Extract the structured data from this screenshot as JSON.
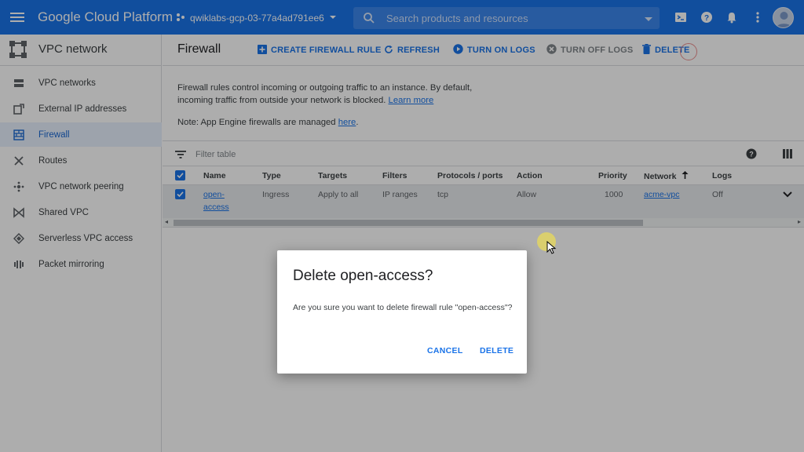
{
  "topbar": {
    "brand": "Google Cloud Platform",
    "project": "qwiklabs-gcp-03-77a4ad791ee6",
    "search_placeholder": "Search products and resources",
    "icons": [
      "menu-icon",
      "project-hub-icon",
      "search-icon",
      "cloud-shell-icon",
      "help-icon",
      "notifications-icon",
      "more-vert-icon",
      "avatar"
    ],
    "color": "#1a73e8"
  },
  "sidebar": {
    "title": "VPC network",
    "items": [
      {
        "label": "VPC networks",
        "icon": "vpc-networks-icon"
      },
      {
        "label": "External IP addresses",
        "icon": "external-ip-icon"
      },
      {
        "label": "Firewall",
        "icon": "firewall-icon",
        "active": true
      },
      {
        "label": "Routes",
        "icon": "routes-icon"
      },
      {
        "label": "VPC network peering",
        "icon": "peering-icon"
      },
      {
        "label": "Shared VPC",
        "icon": "shared-vpc-icon"
      },
      {
        "label": "Serverless VPC access",
        "icon": "serverless-icon"
      },
      {
        "label": "Packet mirroring",
        "icon": "packet-mirroring-icon"
      }
    ]
  },
  "toolbar": {
    "title": "Firewall",
    "create": "CREATE FIREWALL RULE",
    "refresh": "REFRESH",
    "logs_on": "TURN ON LOGS",
    "logs_off": "TURN OFF LOGS",
    "delete": "DELETE"
  },
  "info": {
    "text": "Firewall rules control incoming or outgoing traffic to an instance. By default, incoming traffic from outside your network is blocked.",
    "learn_more": "Learn more",
    "note": "Note: App Engine firewalls are managed",
    "note_link": "here",
    "note_end": "."
  },
  "filter": {
    "placeholder": "Filter table"
  },
  "table": {
    "columns": [
      "Name",
      "Type",
      "Targets",
      "Filters",
      "Protocols / ports",
      "Action",
      "Priority",
      "Network",
      "Logs"
    ],
    "sort_icon": "arrow-up-icon",
    "rows": [
      {
        "name_line1": "open-",
        "name_line2": "access",
        "type": "Ingress",
        "targets": "Apply to all",
        "filters": "IP ranges",
        "protocols": "tcp",
        "action": "Allow",
        "priority": "1000",
        "network": "acme-vpc",
        "logs": "Off"
      }
    ]
  },
  "dialog": {
    "title": "Delete open-access?",
    "message": "Are you sure you want to delete firewall rule \"open-access\"?",
    "cancel": "CANCEL",
    "confirm": "DELETE"
  }
}
